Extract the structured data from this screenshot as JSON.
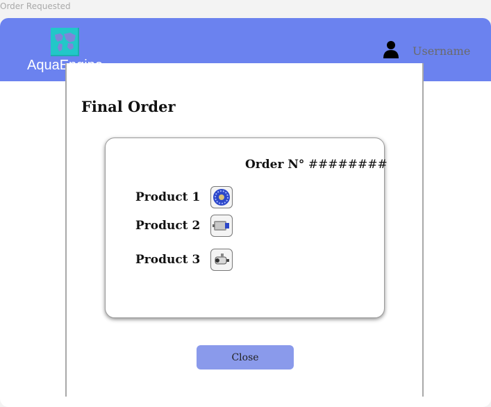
{
  "window": {
    "title": "Order Requested"
  },
  "header": {
    "brand": "AquaEngine",
    "username": "Username",
    "logo_icon": "world-map-logo-icon",
    "user_icon": "user-icon"
  },
  "main": {
    "title": "Final Order",
    "order": {
      "label": "Order N°",
      "number": "########"
    },
    "products": [
      {
        "name": "Product 1",
        "icon": "product-impeller-icon"
      },
      {
        "name": "Product 2",
        "icon": "product-motor-icon"
      },
      {
        "name": "Product 3",
        "icon": "product-pump-icon"
      }
    ],
    "close_label": "Close"
  },
  "colors": {
    "header": "#6b82ef",
    "logo": "#22c7c8",
    "button": "#8a9aeb"
  }
}
